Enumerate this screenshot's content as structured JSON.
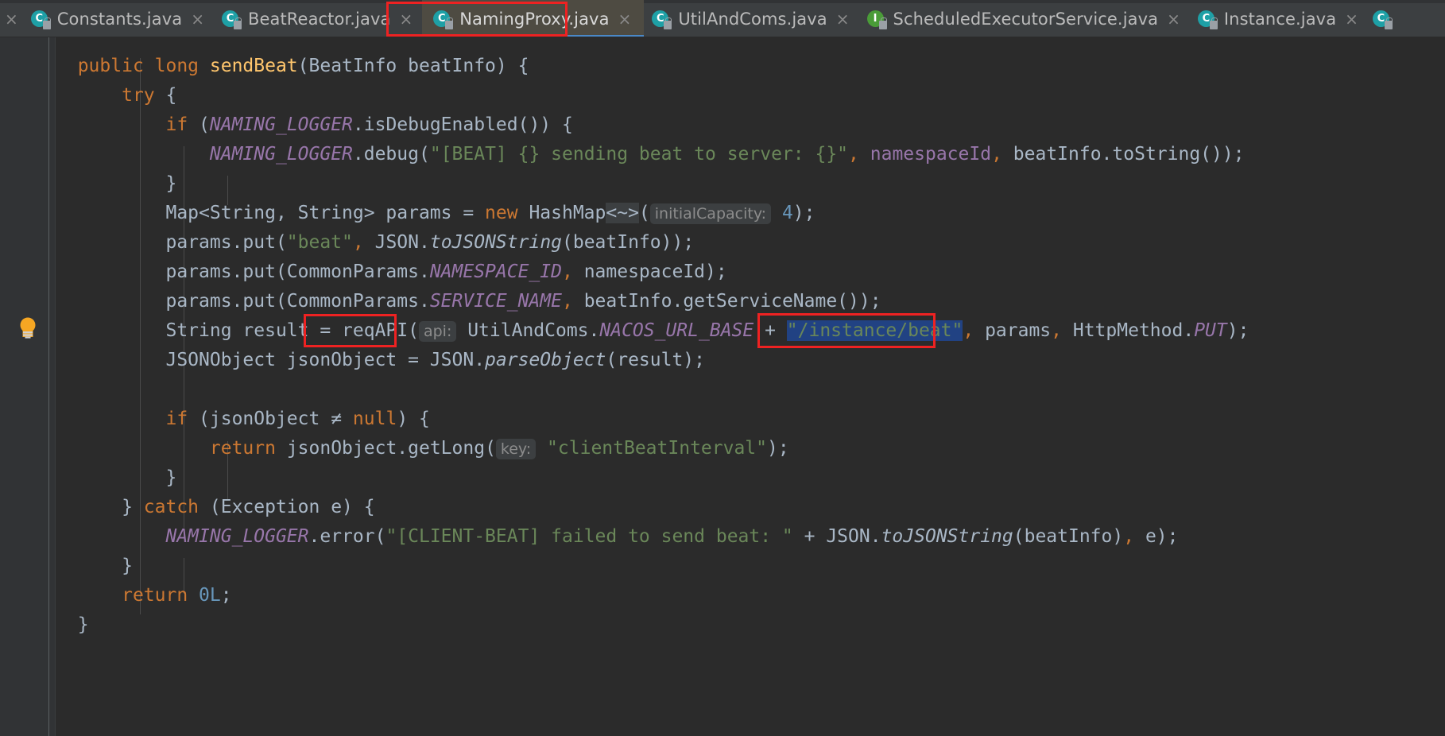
{
  "window": {
    "theme": "darcula",
    "background": "#2b2b2b",
    "accent_tab_underline": "#4a88c7",
    "highlight_box_color": "#ee2222",
    "selection_color": "#214283"
  },
  "tabbar": {
    "tabs": [
      {
        "label": "Constants.java",
        "icon": "java-class-icon",
        "kind": "class",
        "active": false,
        "close": "×"
      },
      {
        "label": "BeatReactor.java",
        "icon": "java-class-icon",
        "kind": "class",
        "active": false,
        "close": "×"
      },
      {
        "label": "NamingProxy.java",
        "icon": "java-class-icon",
        "kind": "class",
        "active": true,
        "close": "×"
      },
      {
        "label": "UtilAndComs.java",
        "icon": "java-class-icon",
        "kind": "class",
        "active": false,
        "close": "×"
      },
      {
        "label": "ScheduledExecutorService.java",
        "icon": "java-interface-icon",
        "kind": "interface",
        "active": false,
        "close": "×"
      },
      {
        "label": "Instance.java",
        "icon": "java-class-icon",
        "kind": "class",
        "active": false,
        "close": "×"
      }
    ],
    "class_glyph": "C",
    "interface_glyph": "I",
    "leading_close": "×"
  },
  "gutter": {
    "intention_bulb": "lightbulb-icon",
    "fold_markers": [
      "−",
      "−",
      "−",
      "−",
      "−",
      "−",
      "−",
      "−"
    ]
  },
  "code": {
    "language": "java",
    "method": "sendBeat",
    "lines": [
      "    public long sendBeat(BeatInfo beatInfo) {",
      "        try {",
      "            if (NAMING_LOGGER.isDebugEnabled()) {",
      "                NAMING_LOGGER.debug(\"[BEAT] {} sending beat to server: {}\", namespaceId, beatInfo.toString());",
      "            }",
      "            Map<String, String> params = new HashMap<>( initialCapacity: 4);",
      "            params.put(\"beat\", JSON.toJSONString(beatInfo));",
      "            params.put(CommonParams.NAMESPACE_ID, namespaceId);",
      "            params.put(CommonParams.SERVICE_NAME, beatInfo.getServiceName());",
      "            String result = reqAPI( api: UtilAndComs.NACOS_URL_BASE + \"/instance/beat\", params, HttpMethod.PUT);",
      "            JSONObject jsonObject = JSON.parseObject(result);",
      "",
      "            if (jsonObject != null) {",
      "                return jsonObject.getLong( key: \"clientBeatInterval\");",
      "            }",
      "        } catch (Exception e) {",
      "            NAMING_LOGGER.error(\"[CLIENT-BEAT] failed to send beat: \" + JSON.toJSONString(beatInfo), e);",
      "        }",
      "        return 0L;",
      "    }"
    ],
    "inlay_hints": [
      {
        "label": "initialCapacity:",
        "line": 5
      },
      {
        "label": "api:",
        "line": 9
      },
      {
        "label": "key:",
        "line": 13
      }
    ],
    "strings": [
      "\"[BEAT] {} sending beat to server: {}\"",
      "\"beat\"",
      "\"/instance/beat\"",
      "\"clientBeatInterval\"",
      "\"[CLIENT-BEAT] failed to send beat: \""
    ],
    "selected_text": "\"/instance/beat\"",
    "highlighted_call": "reqAPI(",
    "keywords": [
      "public",
      "long",
      "try",
      "if",
      "new",
      "null",
      "return",
      "catch"
    ],
    "numbers": [
      "4",
      "0L"
    ],
    "static_fields": [
      "NAMING_LOGGER",
      "NAMESPACE_ID",
      "SERVICE_NAME",
      "NACOS_URL_BASE",
      "PUT"
    ]
  },
  "annotations": {
    "boxes": [
      {
        "target": "active-tab-NamingProxy",
        "color": "#ee2222"
      },
      {
        "target": "reqAPI-call",
        "color": "#ee2222"
      },
      {
        "target": "instance-beat-string",
        "color": "#ee2222"
      }
    ]
  }
}
